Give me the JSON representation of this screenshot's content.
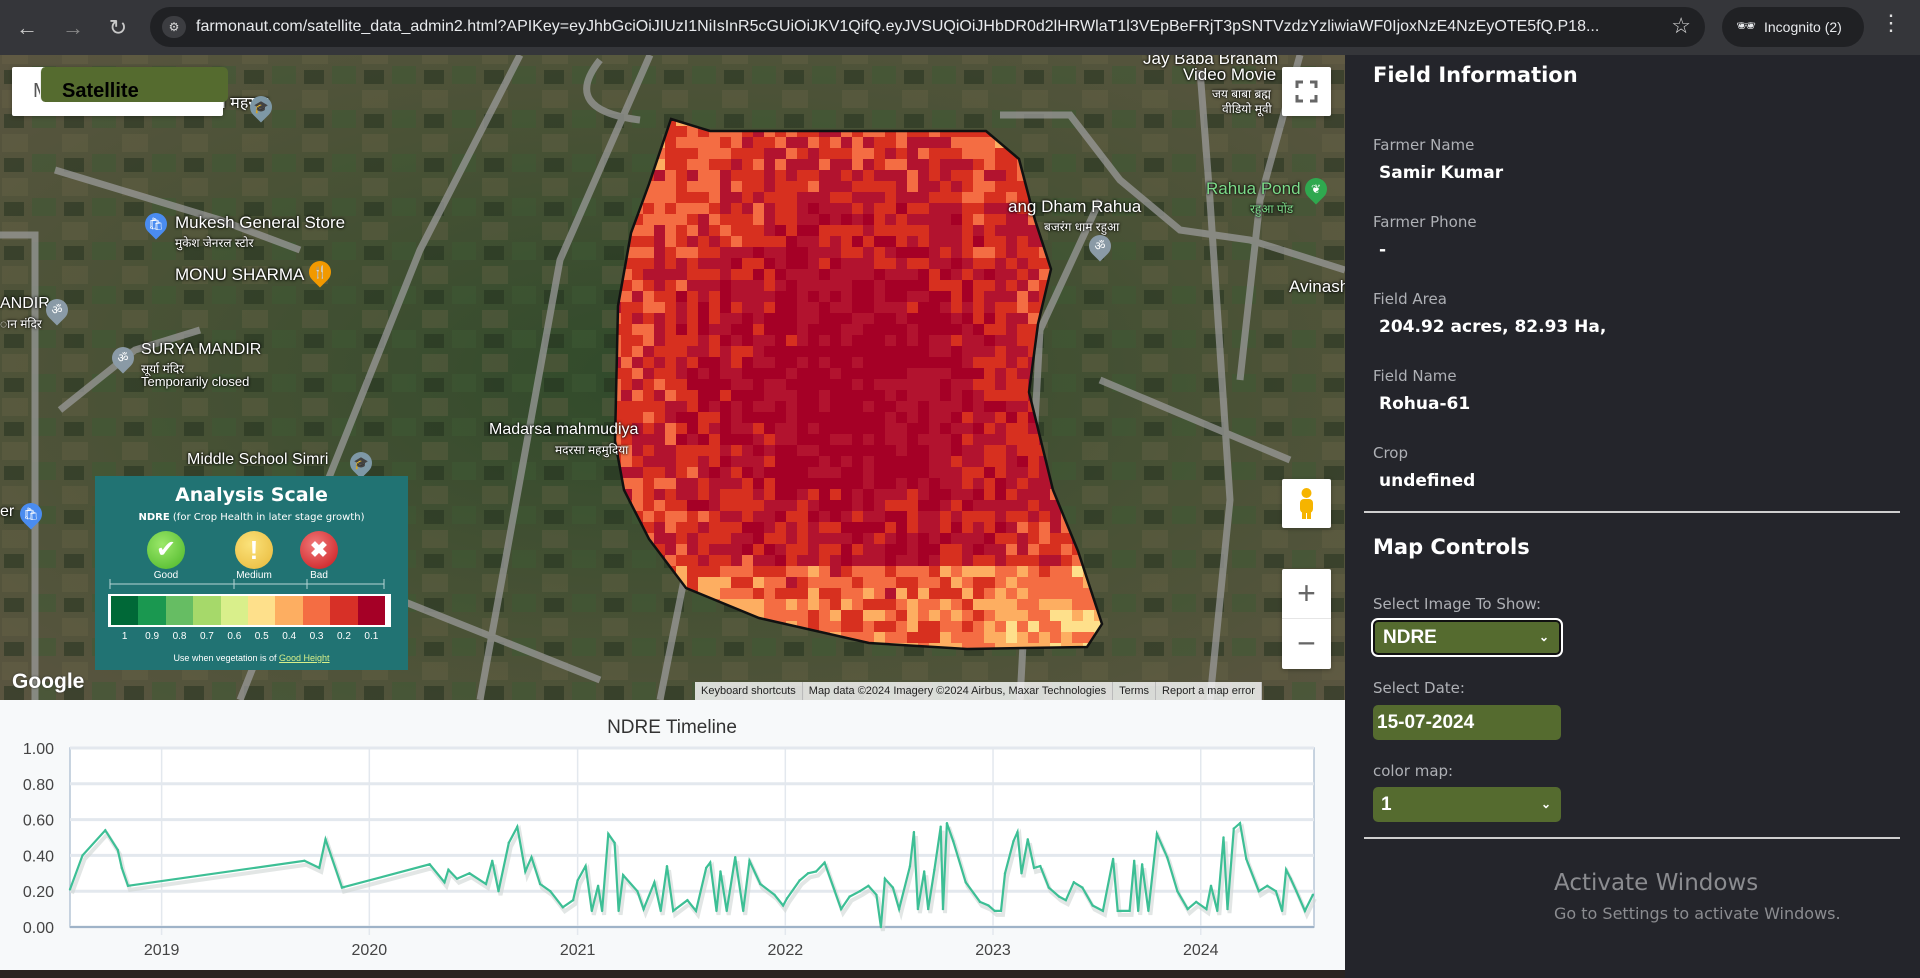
{
  "browser": {
    "url": "farmonaut.com/satellite_data_admin2.html?APIKey=eyJhbGciOiJIUzI1NiIsInR5cGUiOiJKV1QifQ.eyJVSUQiOiJHbDR0d2lHRWlaT1l3VEpBeFRjT3pSNTVzdzYzliwiaWF0IjoxNzE4NzEyOTE5fQ.P18...",
    "incognito_label": "Incognito (2)",
    "icons": [
      "back-icon",
      "forward-icon",
      "reload-icon",
      "site-settings-icon",
      "star-icon",
      "incognito-icon",
      "menu-icon"
    ]
  },
  "map": {
    "type_buttons": [
      "Map",
      "Satellite"
    ],
    "selected_type": "Satellite",
    "labels": {
      "school_top": "मिक विद्यालय महखर",
      "mukesh": "Mukesh General Store",
      "mukesh_hi": "मुकेश जेनरल स्टोर",
      "monu": "MONU SHARMA",
      "mandir_left": "ANDIR",
      "mandir_left_hi": "ान मंदिर",
      "surya": "SURYA MANDIR",
      "surya_hi": "सूर्या मंदिर",
      "surya_status": "Temporarily closed",
      "middle_school": "Middle School Simri",
      "madarsa": "Madarsa mahmudiya",
      "madarsa_hi": "मदरसा महमुदिया",
      "bajrang": "ang Dham Rahua",
      "bajrang_hi": "बजरंग धाम रहुआ",
      "rahua_pond": "Rahua Pond",
      "rahua_pond_hi": "रहुआ पोंड",
      "jay_baba": "Jay Baba Branam",
      "video_movie": "Video Movie",
      "jay_baba_hi": "जय बाबा ब्रह्म",
      "video_hi": "वीडियो मूवी",
      "avinash": "Avinash",
      "left_er": "er"
    },
    "google_logo": "Google",
    "attribution": [
      "Keyboard shortcuts",
      "Map data ©2024 Imagery ©2024 Airbus, Maxar Technologies",
      "Terms",
      "Report a map error"
    ],
    "controls": {
      "zoom_in": "+",
      "zoom_out": "−"
    },
    "heatmap_colors": [
      "#a50026",
      "#b2132f",
      "#d7301f",
      "#f46d43",
      "#fdae61",
      "#fee08b",
      "#d9ef8b"
    ],
    "legend": {
      "title": "Analysis Scale",
      "index": "NDRE",
      "subtitle": "(for Crop Health in later stage growth)",
      "levels": [
        "Good",
        "Medium",
        "Bad"
      ],
      "scale_values": [
        "1",
        "0.9",
        "0.8",
        "0.7",
        "0.6",
        "0.5",
        "0.4",
        "0.3",
        "0.2",
        "0.1"
      ],
      "scale_colors": [
        "#006837",
        "#1a9850",
        "#66bd63",
        "#a6d96a",
        "#d9ef8b",
        "#fee08b",
        "#fdae61",
        "#f46d43",
        "#d73027",
        "#a50026"
      ],
      "footer_prefix": "Use when vegetation is of",
      "footer_link": "Good Height"
    }
  },
  "sidebar": {
    "field_info_title": "Field Information",
    "fields": [
      {
        "label": "Farmer Name",
        "value": "Samir Kumar"
      },
      {
        "label": "Farmer Phone",
        "value": "-"
      },
      {
        "label": "Field Area",
        "value": "204.92 acres, 82.93 Ha,"
      },
      {
        "label": "Field Name",
        "value": "Rohua-61"
      },
      {
        "label": "Crop",
        "value": "undefined"
      }
    ],
    "map_controls_title": "Map Controls",
    "image_label": "Select Image To Show:",
    "image_value": "NDRE",
    "date_label": "Select Date:",
    "date_value": "15-07-2024",
    "colormap_label": "color map:",
    "colormap_value": "1",
    "control_color": "#556b2f"
  },
  "watermark": {
    "title": "Activate Windows",
    "subtitle": "Go to Settings to activate Windows."
  },
  "chart_data": {
    "type": "line",
    "title": "NDRE Timeline",
    "ylim": [
      0,
      1
    ],
    "yticks": [
      "0.00",
      "0.20",
      "0.40",
      "0.60",
      "0.80",
      "1.00"
    ],
    "xticks": [
      "2019",
      "2020",
      "2021",
      "2022",
      "2023",
      "2024"
    ],
    "xlim": [
      "2018-07-24",
      "2024-07-18"
    ],
    "grid": true,
    "color": "#3dbf95",
    "series": [
      {
        "points": [
          [
            "2018-07-24",
            0.21
          ],
          [
            "2018-08-15",
            0.4
          ],
          [
            "2018-09-24",
            0.54
          ],
          [
            "2018-10-16",
            0.43
          ],
          [
            "2018-10-23",
            0.33
          ],
          [
            "2018-11-03",
            0.23
          ],
          [
            "2019-09-09",
            0.37
          ],
          [
            "2019-10-05",
            0.33
          ],
          [
            "2019-10-16",
            0.49
          ],
          [
            "2019-11-14",
            0.22
          ],
          [
            "2020-04-16",
            0.35
          ],
          [
            "2020-05-12",
            0.25
          ],
          [
            "2020-05-19",
            0.32
          ],
          [
            "2020-06-03",
            0.27
          ],
          [
            "2020-06-25",
            0.3
          ],
          [
            "2020-07-24",
            0.24
          ],
          [
            "2020-08-04",
            0.37
          ],
          [
            "2020-08-15",
            0.2
          ],
          [
            "2020-09-02",
            0.47
          ],
          [
            "2020-09-17",
            0.56
          ],
          [
            "2020-10-01",
            0.31
          ],
          [
            "2020-10-12",
            0.39
          ],
          [
            "2020-10-27",
            0.24
          ],
          [
            "2020-11-14",
            0.2
          ],
          [
            "2020-12-06",
            0.11
          ],
          [
            "2020-12-24",
            0.15
          ],
          [
            "2021-01-01",
            0.26
          ],
          [
            "2021-01-15",
            0.34
          ],
          [
            "2021-01-26",
            0.09
          ],
          [
            "2021-02-06",
            0.23
          ],
          [
            "2021-02-13",
            0.09
          ],
          [
            "2021-02-24",
            0.52
          ],
          [
            "2021-03-07",
            0.47
          ],
          [
            "2021-03-14",
            0.09
          ],
          [
            "2021-03-22",
            0.29
          ],
          [
            "2021-04-16",
            0.2
          ],
          [
            "2021-04-27",
            0.1
          ],
          [
            "2021-05-16",
            0.25
          ],
          [
            "2021-05-27",
            0.09
          ],
          [
            "2021-06-07",
            0.34
          ],
          [
            "2021-06-18",
            0.09
          ],
          [
            "2021-07-13",
            0.15
          ],
          [
            "2021-07-28",
            0.09
          ],
          [
            "2021-08-15",
            0.33
          ],
          [
            "2021-08-22",
            0.36
          ],
          [
            "2021-09-02",
            0.09
          ],
          [
            "2021-09-09",
            0.31
          ],
          [
            "2021-09-20",
            0.09
          ],
          [
            "2021-10-05",
            0.39
          ],
          [
            "2021-10-19",
            0.09
          ],
          [
            "2021-10-30",
            0.37
          ],
          [
            "2021-11-18",
            0.24
          ],
          [
            "2021-12-13",
            0.18
          ],
          [
            "2021-12-28",
            0.12
          ],
          [
            "2022-01-04",
            0.16
          ],
          [
            "2022-01-26",
            0.26
          ],
          [
            "2022-02-10",
            0.3
          ],
          [
            "2022-02-24",
            0.31
          ],
          [
            "2022-03-11",
            0.36
          ],
          [
            "2022-03-29",
            0.2
          ],
          [
            "2022-04-09",
            0.1
          ],
          [
            "2022-04-24",
            0.17
          ],
          [
            "2022-05-12",
            0.2
          ],
          [
            "2022-05-27",
            0.23
          ],
          [
            "2022-06-10",
            0.18
          ],
          [
            "2022-06-18",
            0.0
          ],
          [
            "2022-06-25",
            0.27
          ],
          [
            "2022-07-09",
            0.22
          ],
          [
            "2022-07-20",
            0.1
          ],
          [
            "2022-08-08",
            0.34
          ],
          [
            "2022-08-15",
            0.53
          ],
          [
            "2022-08-22",
            0.1
          ],
          [
            "2022-09-02",
            0.31
          ],
          [
            "2022-09-09",
            0.1
          ],
          [
            "2022-09-20",
            0.32
          ],
          [
            "2022-10-01",
            0.56
          ],
          [
            "2022-10-05",
            0.1
          ],
          [
            "2022-10-12",
            0.58
          ],
          [
            "2022-10-23",
            0.48
          ],
          [
            "2022-11-14",
            0.25
          ],
          [
            "2022-12-09",
            0.14
          ],
          [
            "2022-12-24",
            0.12
          ],
          [
            "2023-01-04",
            0.09
          ],
          [
            "2023-01-15",
            0.09
          ],
          [
            "2023-01-22",
            0.3
          ],
          [
            "2023-02-06",
            0.48
          ],
          [
            "2023-02-13",
            0.53
          ],
          [
            "2023-02-20",
            0.3
          ],
          [
            "2023-03-03",
            0.49
          ],
          [
            "2023-03-14",
            0.33
          ],
          [
            "2023-03-25",
            0.34
          ],
          [
            "2023-04-09",
            0.22
          ],
          [
            "2023-04-27",
            0.17
          ],
          [
            "2023-05-09",
            0.15
          ],
          [
            "2023-05-23",
            0.25
          ],
          [
            "2023-06-07",
            0.22
          ],
          [
            "2023-06-25",
            0.12
          ],
          [
            "2023-07-13",
            0.09
          ],
          [
            "2023-07-31",
            0.38
          ],
          [
            "2023-08-08",
            0.09
          ],
          [
            "2023-08-29",
            0.09
          ],
          [
            "2023-09-06",
            0.37
          ],
          [
            "2023-09-13",
            0.09
          ],
          [
            "2023-09-20",
            0.35
          ],
          [
            "2023-10-01",
            0.09
          ],
          [
            "2023-10-16",
            0.52
          ],
          [
            "2023-11-03",
            0.39
          ],
          [
            "2023-11-21",
            0.2
          ],
          [
            "2023-12-09",
            0.1
          ],
          [
            "2023-12-24",
            0.14
          ],
          [
            "2024-01-11",
            0.1
          ],
          [
            "2024-01-19",
            0.23
          ],
          [
            "2024-01-30",
            0.09
          ],
          [
            "2024-02-10",
            0.5
          ],
          [
            "2024-02-17",
            0.1
          ],
          [
            "2024-02-28",
            0.55
          ],
          [
            "2024-03-10",
            0.58
          ],
          [
            "2024-03-21",
            0.38
          ],
          [
            "2024-04-12",
            0.2
          ],
          [
            "2024-04-27",
            0.23
          ],
          [
            "2024-05-12",
            0.2
          ],
          [
            "2024-05-23",
            0.09
          ],
          [
            "2024-05-30",
            0.32
          ],
          [
            "2024-06-07",
            0.27
          ],
          [
            "2024-06-17",
            0.2
          ],
          [
            "2024-07-02",
            0.09
          ],
          [
            "2024-07-16",
            0.18
          ]
        ]
      }
    ]
  }
}
